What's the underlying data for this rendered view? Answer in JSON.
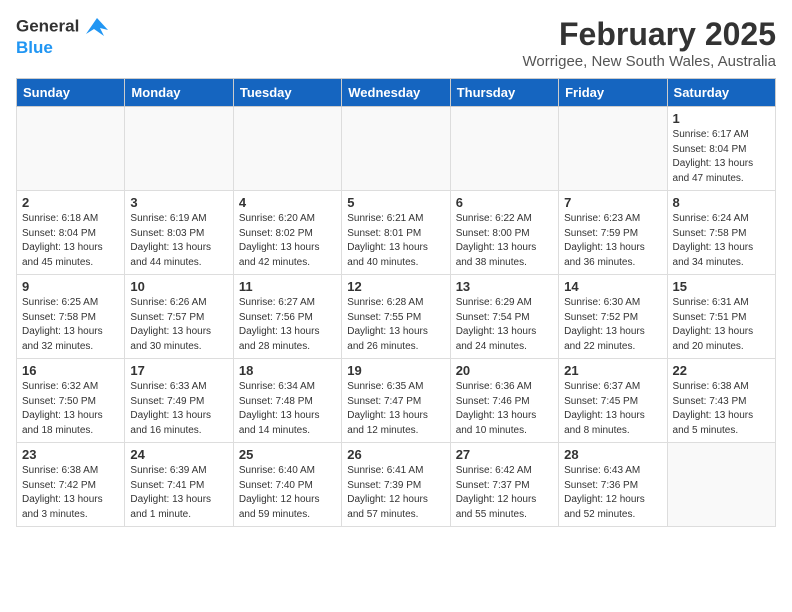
{
  "logo": {
    "line1": "General",
    "line2": "Blue"
  },
  "title": "February 2025",
  "subtitle": "Worrigee, New South Wales, Australia",
  "weekdays": [
    "Sunday",
    "Monday",
    "Tuesday",
    "Wednesday",
    "Thursday",
    "Friday",
    "Saturday"
  ],
  "weeks": [
    [
      {
        "day": "",
        "info": ""
      },
      {
        "day": "",
        "info": ""
      },
      {
        "day": "",
        "info": ""
      },
      {
        "day": "",
        "info": ""
      },
      {
        "day": "",
        "info": ""
      },
      {
        "day": "",
        "info": ""
      },
      {
        "day": "1",
        "info": "Sunrise: 6:17 AM\nSunset: 8:04 PM\nDaylight: 13 hours\nand 47 minutes."
      }
    ],
    [
      {
        "day": "2",
        "info": "Sunrise: 6:18 AM\nSunset: 8:04 PM\nDaylight: 13 hours\nand 45 minutes."
      },
      {
        "day": "3",
        "info": "Sunrise: 6:19 AM\nSunset: 8:03 PM\nDaylight: 13 hours\nand 44 minutes."
      },
      {
        "day": "4",
        "info": "Sunrise: 6:20 AM\nSunset: 8:02 PM\nDaylight: 13 hours\nand 42 minutes."
      },
      {
        "day": "5",
        "info": "Sunrise: 6:21 AM\nSunset: 8:01 PM\nDaylight: 13 hours\nand 40 minutes."
      },
      {
        "day": "6",
        "info": "Sunrise: 6:22 AM\nSunset: 8:00 PM\nDaylight: 13 hours\nand 38 minutes."
      },
      {
        "day": "7",
        "info": "Sunrise: 6:23 AM\nSunset: 7:59 PM\nDaylight: 13 hours\nand 36 minutes."
      },
      {
        "day": "8",
        "info": "Sunrise: 6:24 AM\nSunset: 7:58 PM\nDaylight: 13 hours\nand 34 minutes."
      }
    ],
    [
      {
        "day": "9",
        "info": "Sunrise: 6:25 AM\nSunset: 7:58 PM\nDaylight: 13 hours\nand 32 minutes."
      },
      {
        "day": "10",
        "info": "Sunrise: 6:26 AM\nSunset: 7:57 PM\nDaylight: 13 hours\nand 30 minutes."
      },
      {
        "day": "11",
        "info": "Sunrise: 6:27 AM\nSunset: 7:56 PM\nDaylight: 13 hours\nand 28 minutes."
      },
      {
        "day": "12",
        "info": "Sunrise: 6:28 AM\nSunset: 7:55 PM\nDaylight: 13 hours\nand 26 minutes."
      },
      {
        "day": "13",
        "info": "Sunrise: 6:29 AM\nSunset: 7:54 PM\nDaylight: 13 hours\nand 24 minutes."
      },
      {
        "day": "14",
        "info": "Sunrise: 6:30 AM\nSunset: 7:52 PM\nDaylight: 13 hours\nand 22 minutes."
      },
      {
        "day": "15",
        "info": "Sunrise: 6:31 AM\nSunset: 7:51 PM\nDaylight: 13 hours\nand 20 minutes."
      }
    ],
    [
      {
        "day": "16",
        "info": "Sunrise: 6:32 AM\nSunset: 7:50 PM\nDaylight: 13 hours\nand 18 minutes."
      },
      {
        "day": "17",
        "info": "Sunrise: 6:33 AM\nSunset: 7:49 PM\nDaylight: 13 hours\nand 16 minutes."
      },
      {
        "day": "18",
        "info": "Sunrise: 6:34 AM\nSunset: 7:48 PM\nDaylight: 13 hours\nand 14 minutes."
      },
      {
        "day": "19",
        "info": "Sunrise: 6:35 AM\nSunset: 7:47 PM\nDaylight: 13 hours\nand 12 minutes."
      },
      {
        "day": "20",
        "info": "Sunrise: 6:36 AM\nSunset: 7:46 PM\nDaylight: 13 hours\nand 10 minutes."
      },
      {
        "day": "21",
        "info": "Sunrise: 6:37 AM\nSunset: 7:45 PM\nDaylight: 13 hours\nand 8 minutes."
      },
      {
        "day": "22",
        "info": "Sunrise: 6:38 AM\nSunset: 7:43 PM\nDaylight: 13 hours\nand 5 minutes."
      }
    ],
    [
      {
        "day": "23",
        "info": "Sunrise: 6:38 AM\nSunset: 7:42 PM\nDaylight: 13 hours\nand 3 minutes."
      },
      {
        "day": "24",
        "info": "Sunrise: 6:39 AM\nSunset: 7:41 PM\nDaylight: 13 hours\nand 1 minute."
      },
      {
        "day": "25",
        "info": "Sunrise: 6:40 AM\nSunset: 7:40 PM\nDaylight: 12 hours\nand 59 minutes."
      },
      {
        "day": "26",
        "info": "Sunrise: 6:41 AM\nSunset: 7:39 PM\nDaylight: 12 hours\nand 57 minutes."
      },
      {
        "day": "27",
        "info": "Sunrise: 6:42 AM\nSunset: 7:37 PM\nDaylight: 12 hours\nand 55 minutes."
      },
      {
        "day": "28",
        "info": "Sunrise: 6:43 AM\nSunset: 7:36 PM\nDaylight: 12 hours\nand 52 minutes."
      },
      {
        "day": "",
        "info": ""
      }
    ]
  ]
}
